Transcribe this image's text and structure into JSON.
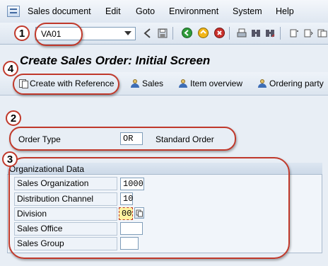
{
  "menu": {
    "items": [
      "Sales document",
      "Edit",
      "Goto",
      "Environment",
      "System",
      "Help"
    ]
  },
  "toolbar": {
    "command_value": "VA01",
    "icons": [
      "enter-icon",
      "save-icon",
      "back-icon",
      "exit-icon",
      "cancel-icon",
      "print-icon",
      "find-icon",
      "find-next-icon",
      "first-page-icon",
      "prev-page-icon",
      "next-page-icon",
      "last-page-icon",
      "new-session-icon",
      "shortcut-icon"
    ]
  },
  "title": "Create Sales Order: Initial Screen",
  "app_toolbar": {
    "create_with_reference": "Create with Reference",
    "sales": "Sales",
    "item_overview": "Item overview",
    "ordering_party": "Ordering party"
  },
  "order": {
    "type_label": "Order Type",
    "type_value": "OR",
    "type_description": "Standard Order"
  },
  "org_data": {
    "header": "Organizational Data",
    "fields": [
      {
        "label": "Sales Organization",
        "value": "1000"
      },
      {
        "label": "Distribution Channel",
        "value": "10"
      },
      {
        "label": "Division",
        "value": "00"
      },
      {
        "label": "Sales Office",
        "value": ""
      },
      {
        "label": "Sales Group",
        "value": ""
      }
    ]
  },
  "callouts": [
    "1",
    "2",
    "3",
    "4"
  ],
  "colors": {
    "callout": "#c0392b",
    "title_bg": "#dce6f2",
    "highlight_field": "#fff3a0"
  }
}
